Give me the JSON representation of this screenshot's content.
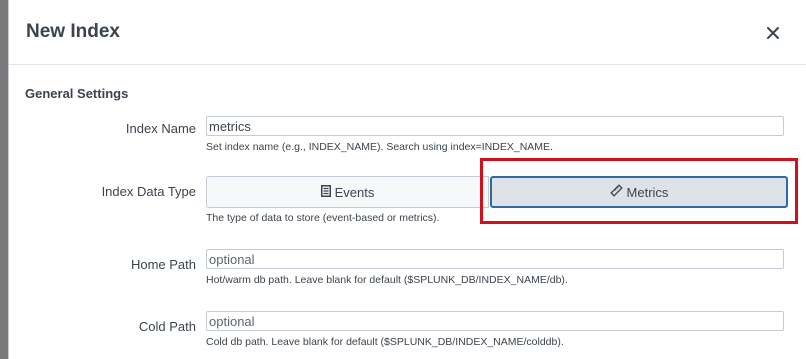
{
  "modal": {
    "title": "New Index",
    "close_icon": "close-icon"
  },
  "general_settings": {
    "title": "General Settings",
    "index_name": {
      "label": "Index Name",
      "value": "metrics",
      "help": "Set index name (e.g., INDEX_NAME). Search using index=INDEX_NAME."
    },
    "index_data_type": {
      "label": "Index Data Type",
      "options": [
        {
          "label": "Events",
          "icon": "document-icon",
          "selected": false
        },
        {
          "label": "Metrics",
          "icon": "ruler-icon",
          "selected": true
        }
      ],
      "help": "The type of data to store (event-based or metrics)."
    },
    "home_path": {
      "label": "Home Path",
      "placeholder": "optional",
      "help": "Hot/warm db path. Leave blank for default ($SPLUNK_DB/INDEX_NAME/db)."
    },
    "cold_path": {
      "label": "Cold Path",
      "placeholder": "optional",
      "help": "Cold db path. Leave blank for default ($SPLUNK_DB/INDEX_NAME/colddb)."
    }
  },
  "colors": {
    "highlight": "#d0101a",
    "selected_border": "#2e6aa0"
  }
}
